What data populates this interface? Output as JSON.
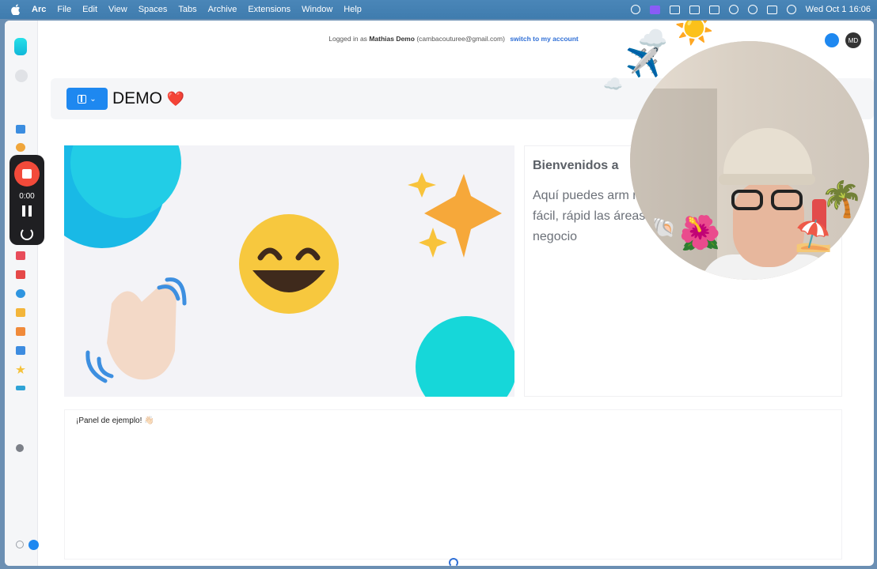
{
  "menubar": {
    "app": "Arc",
    "items": [
      "File",
      "Edit",
      "View",
      "Spaces",
      "Tabs",
      "Archive",
      "Extensions",
      "Window",
      "Help"
    ],
    "clock": "Wed Oct 1  16:06"
  },
  "login_bar": {
    "prefix": "Logged in as",
    "name": "Mathias Demo",
    "email": "(cambacouturee@gmail.com)",
    "switch_label": "switch to my account"
  },
  "header": {
    "title": "DEMO",
    "title_emoji": "❤️",
    "avatar_initials": "MD"
  },
  "recorder": {
    "time": "0:00"
  },
  "welcome": {
    "title": "Bienvenidos a",
    "description": "Aquí puedes arm manera fácil, rápid las áreas de tu negocio"
  },
  "panel": {
    "title": "¡Panel de ejemplo! 👋🏻"
  },
  "colors": {
    "accent": "#1e88f0",
    "recorder_stop": "#f24a3a",
    "logo": "#10b7d9"
  },
  "icons": {
    "hero_emojis": [
      "😄",
      "👋🏻",
      "✨"
    ],
    "overlay_emojis": [
      "☀️",
      "✈️",
      "☁️",
      "🌴",
      "🌺",
      "⛱️",
      "🐚"
    ]
  }
}
